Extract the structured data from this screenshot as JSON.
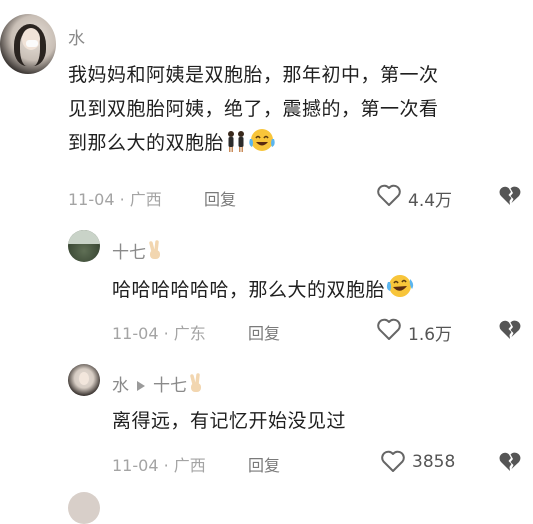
{
  "comments": [
    {
      "username": "水",
      "text_lines": [
        "我妈妈和阿姨是双胞胎，那年初中，第一次",
        "见到双胞胎阿姨，绝了，震撼的，第一次看",
        "到那么大的双胞胎"
      ],
      "meta": "11-04 · 广西",
      "reply_label": "回复",
      "likes": "4.4万"
    },
    {
      "username": "十七",
      "text": "哈哈哈哈哈哈，那么大的双胞胎",
      "meta": "11-04 · 广东",
      "reply_label": "回复",
      "likes": "1.6万"
    },
    {
      "username_from": "水",
      "username_to": "十七",
      "text": "离得远，有记忆开始没见过",
      "meta": "11-04 · 广西",
      "reply_label": "回复",
      "likes": "3858"
    }
  ],
  "icons": {
    "like": "heart-outline-icon",
    "dislike": "broken-heart-icon",
    "victory": "victory-hand-emoji",
    "twins": "twins-emoji",
    "laugh_cry": "laughing-crying-emoji"
  },
  "colors": {
    "text": "#1f1f1f",
    "meta": "#a4a4a4",
    "username": "#8a8a8a"
  }
}
